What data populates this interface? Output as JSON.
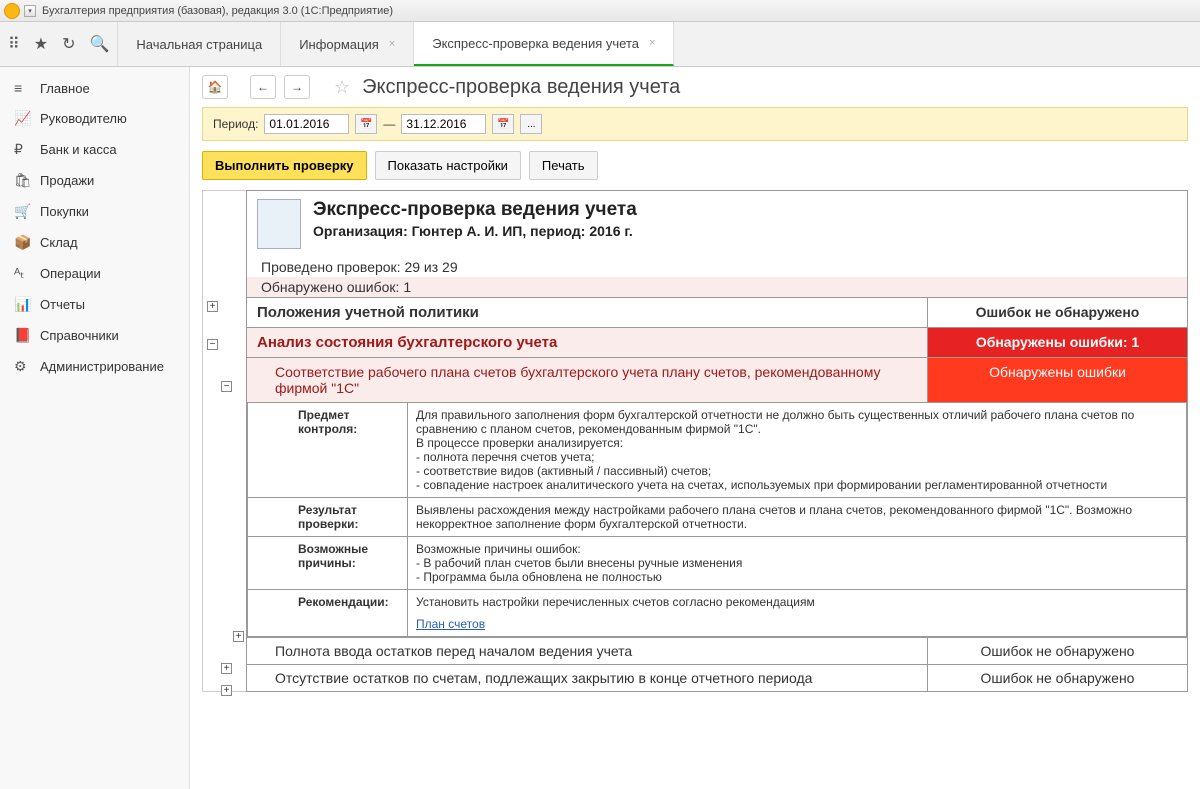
{
  "window_title": "Бухгалтерия предприятия (базовая), редакция 3.0  (1С:Предприятие)",
  "tabs": [
    {
      "label": "Начальная страница",
      "closable": false
    },
    {
      "label": "Информация",
      "closable": true
    },
    {
      "label": "Экспресс-проверка ведения учета",
      "closable": true,
      "active": true
    }
  ],
  "sidebar": [
    {
      "icon": "≡",
      "label": "Главное"
    },
    {
      "icon": "📈",
      "label": "Руководителю"
    },
    {
      "icon": "₽",
      "label": "Банк и касса"
    },
    {
      "icon": "🛍",
      "label": "Продажи"
    },
    {
      "icon": "🛒",
      "label": "Покупки"
    },
    {
      "icon": "📦",
      "label": "Склад"
    },
    {
      "icon": "ᴬₜ",
      "label": "Операции"
    },
    {
      "icon": "📊",
      "label": "Отчеты"
    },
    {
      "icon": "📕",
      "label": "Справочники"
    },
    {
      "icon": "⚙",
      "label": "Администрирование"
    }
  ],
  "page": {
    "title": "Экспресс-проверка ведения учета",
    "period_label": "Период:",
    "date_from": "01.01.2016",
    "date_sep": "—",
    "date_to": "31.12.2016",
    "btn_run": "Выполнить проверку",
    "btn_settings": "Показать настройки",
    "btn_print": "Печать"
  },
  "report": {
    "title": "Экспресс-проверка ведения учета",
    "org_line": "Организация: Гюнтер А. И. ИП, период: 2016 г.",
    "checks_line": "Проведено проверок: 29 из 29",
    "errors_line": "Обнаружено ошибок: 1",
    "sections": [
      {
        "title": "Положения учетной политики",
        "status": "Ошибок не обнаружено",
        "err": false
      },
      {
        "title": "Анализ состояния бухгалтерского учета",
        "status": "Обнаружены ошибки: 1",
        "err": true
      }
    ],
    "subsection": {
      "title": "Соответствие рабочего плана счетов бухгалтерского учета плану счетов, рекомендованному фирмой \"1С\"",
      "status": "Обнаружены ошибки"
    },
    "details": {
      "subject_label": "Предмет контроля:",
      "subject_text": "Для правильного заполнения форм бухгалтерской отчетности не должно быть существенных отличий рабочего плана счетов по сравнению с планом счетов,  рекомендованным фирмой \"1С\".\nВ процессе проверки анализируется:\n- полнота перечня счетов учета;\n- соответствие видов (активный / пассивный) счетов;\n- совпадение настроек аналитического учета на счетах, используемых при формировании регламентированной отчетности",
      "result_label": "Результат проверки:",
      "result_text": "Выявлены расхождения между настройками рабочего плана счетов и плана счетов, рекомендованного фирмой \"1С\". Возможно некорректное заполнение форм бухгалтерской отчетности.",
      "cause_label": "Возможные причины:",
      "cause_text": "Возможные причины ошибок:\n- В рабочий план счетов были внесены ручные изменения\n- Программа была обновлена не полностью",
      "rec_label": "Рекомендации:",
      "rec_text": "Установить настройки перечисленных счетов согласно  рекомендациям",
      "rec_link": "План счетов"
    },
    "tail": [
      {
        "title": "Полнота ввода остатков перед началом ведения учета",
        "status": "Ошибок не обнаружено"
      },
      {
        "title": "Отсутствие остатков по счетам, подлежащих закрытию в конце отчетного периода",
        "status": "Ошибок не обнаружено"
      }
    ]
  }
}
